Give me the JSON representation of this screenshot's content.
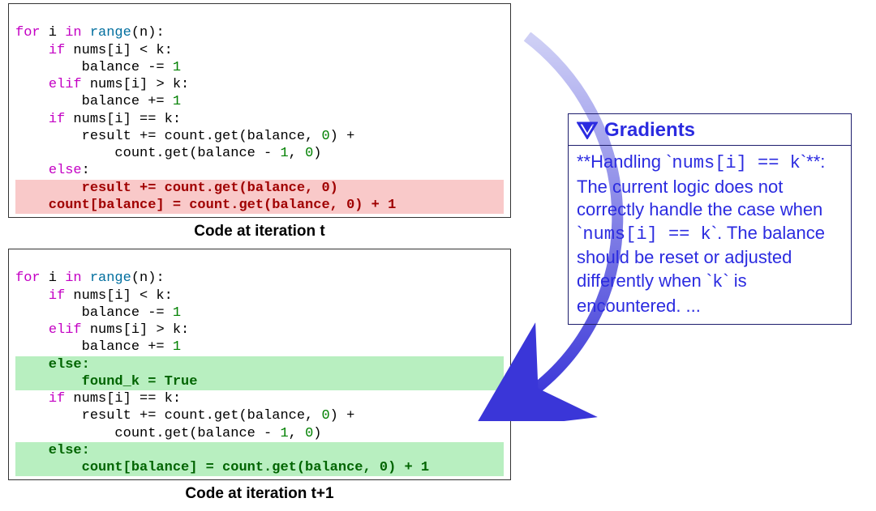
{
  "caption_t": "Code at iteration t",
  "caption_t1": "Code at iteration t+1",
  "code_t": {
    "l1": {
      "for": "for",
      "i": " i ",
      "in": "in",
      "range": " range",
      "paren": "(n):"
    },
    "l2": {
      "if": "if",
      "rest": " nums[i] < k:"
    },
    "l3": "        balance -= ",
    "l3n": "1",
    "l4": {
      "elif": "elif",
      "rest": " nums[i] > k:"
    },
    "l5": "        balance += ",
    "l5n": "1",
    "l6": {
      "if": "if",
      "rest": " nums[i] == k:"
    },
    "l7a": "        result += count.get(balance, ",
    "l7n": "0",
    "l7b": ") +",
    "l8a": "            count.get(balance - ",
    "l8n1": "1",
    "l8b": ", ",
    "l8n0": "0",
    "l8c": ")",
    "l9": {
      "else": "else",
      "colon": ":"
    },
    "l10": "        result += count.get(balance, 0)",
    "l11": "    count[balance] = count.get(balance, 0) + 1"
  },
  "code_t1": {
    "l1": {
      "for": "for",
      "i": " i ",
      "in": "in",
      "range": " range",
      "paren": "(n):"
    },
    "l2": {
      "if": "if",
      "rest": " nums[i] < k:"
    },
    "l3": "        balance -= ",
    "l3n": "1",
    "l4": {
      "elif": "elif",
      "rest": " nums[i] > k:"
    },
    "l5": "        balance += ",
    "l5n": "1",
    "l6a": "    else:",
    "l6b": "        found_k = True",
    "l7": {
      "if": "if",
      "rest": " nums[i] == k:"
    },
    "l8a": "        result += count.get(balance, ",
    "l8n": "0",
    "l8b": ") +",
    "l9a": "            count.get(balance - ",
    "l9n1": "1",
    "l9b": ", ",
    "l9n0": "0",
    "l9c": ")",
    "l10a": "    else:",
    "l10b": "        count[balance] = count.get(balance, 0) + 1"
  },
  "gradients": {
    "title": "Gradients",
    "body_prefix": "**Handling `",
    "body_code": "nums[i] == k",
    "body_mid": "`**: The current logic does not correctly handle the case when `",
    "body_code2": "nums[i] == k",
    "body_mid2": "`. The balance should be reset or adjusted differently when `",
    "body_code3": "k",
    "body_end": "` is encountered. ..."
  }
}
